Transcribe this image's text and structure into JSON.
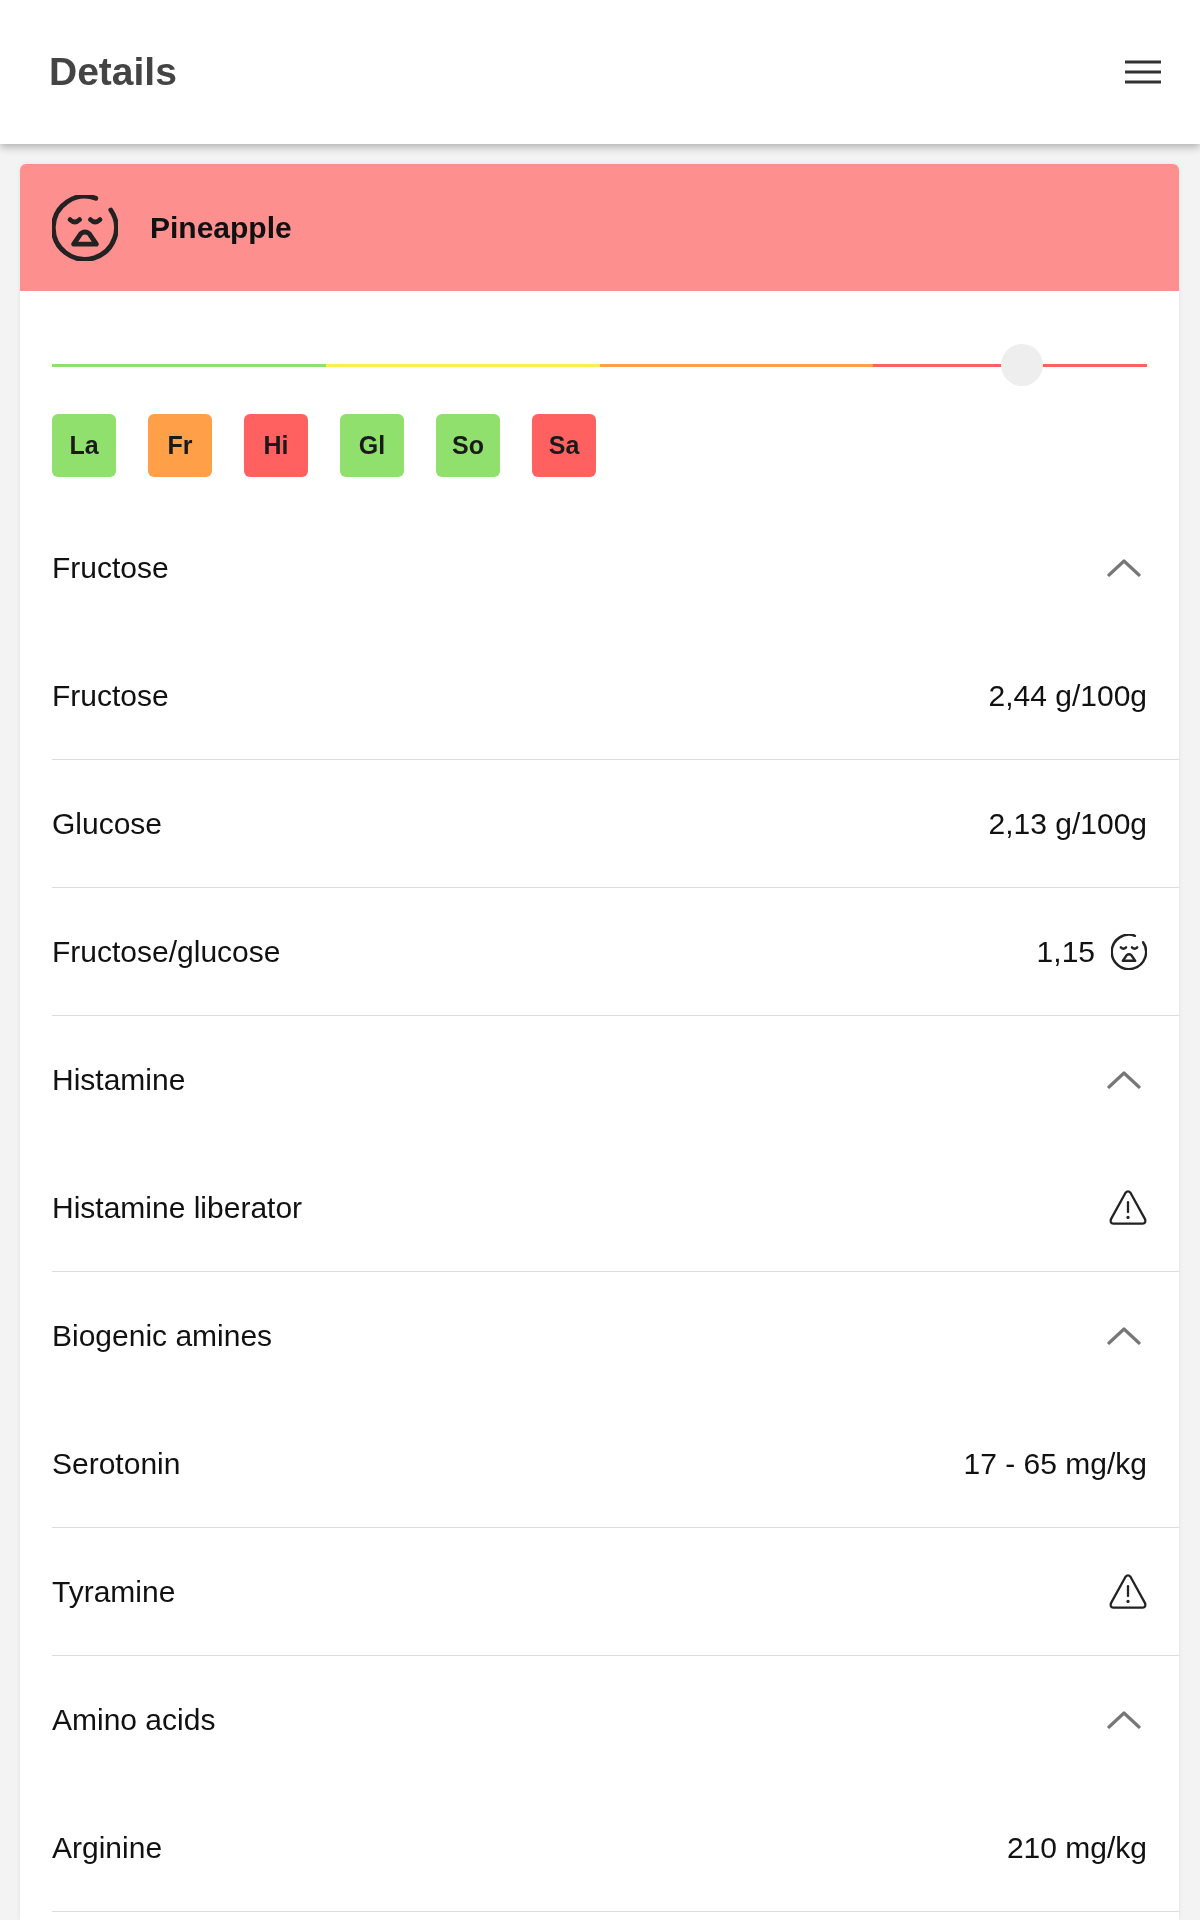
{
  "app_bar": {
    "title": "Details"
  },
  "food": {
    "name": "Pineapple"
  },
  "meter": {
    "level": 0.886
  },
  "tags": [
    {
      "label": "La",
      "color": "#8fe06c"
    },
    {
      "label": "Fr",
      "color": "#ffa048"
    },
    {
      "label": "Hi",
      "color": "#ff6161"
    },
    {
      "label": "Gl",
      "color": "#8fe06c"
    },
    {
      "label": "So",
      "color": "#8fe06c"
    },
    {
      "label": "Sa",
      "color": "#ff6161"
    }
  ],
  "sections": [
    {
      "title": "Fructose",
      "expanded": true,
      "rows": [
        {
          "kind": "value",
          "label": "Fructose",
          "value": "2,44 g/100g"
        },
        {
          "kind": "value",
          "label": "Glucose",
          "value": "2,13 g/100g"
        },
        {
          "kind": "rating",
          "label": "Fructose/glucose",
          "value": "1,15"
        }
      ]
    },
    {
      "title": "Histamine",
      "expanded": true,
      "rows": [
        {
          "kind": "alert",
          "label": "Histamine liberator"
        }
      ]
    },
    {
      "title": "Biogenic amines",
      "expanded": true,
      "rows": [
        {
          "kind": "value",
          "label": "Serotonin",
          "value": "17 - 65 mg/kg"
        },
        {
          "kind": "alert",
          "label": "Tyramine"
        }
      ]
    },
    {
      "title": "Amino acids",
      "expanded": true,
      "rows": [
        {
          "kind": "value",
          "label": "Arginine",
          "value": "210 mg/kg"
        }
      ]
    }
  ]
}
